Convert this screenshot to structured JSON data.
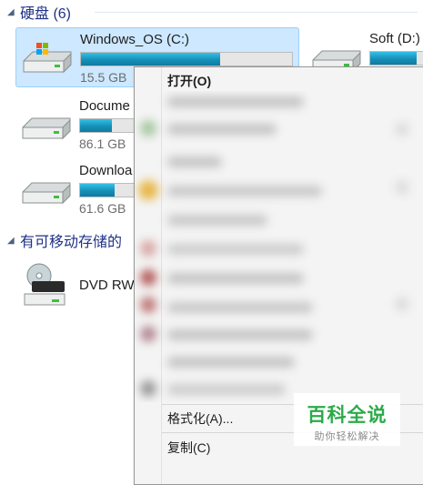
{
  "groups": {
    "hard_disks": "硬盘 (6)",
    "removable": "有可移动存储的"
  },
  "drives": [
    {
      "name": "Windows_OS (C:)",
      "size": "15.5 GB",
      "used_fraction": 0.66
    },
    {
      "name": "Soft (D:)",
      "size": "",
      "used_fraction": 0.85
    },
    {
      "name": "Docume",
      "size": "86.1 GB",
      "used_fraction": 0.58
    },
    {
      "name": "Downloa",
      "size": "61.6 GB",
      "used_fraction": 0.64
    },
    {
      "name": "DVD RW",
      "size": ""
    }
  ],
  "context_menu": {
    "open": "打开(O)",
    "format": "格式化(A)...",
    "copy": "复制(C)"
  },
  "watermark": {
    "title": "百科全说",
    "subtitle": "助你轻松解决"
  },
  "colors": {
    "selection": "#cde8ff",
    "bar_fill": "#26a0da",
    "group_title": "#1e3287",
    "watermark": "#2daa4a"
  },
  "icons": [
    "hard-drive-windows-icon",
    "hard-drive-icon",
    "dvd-drive-icon",
    "collapse-triangle-icon"
  ]
}
